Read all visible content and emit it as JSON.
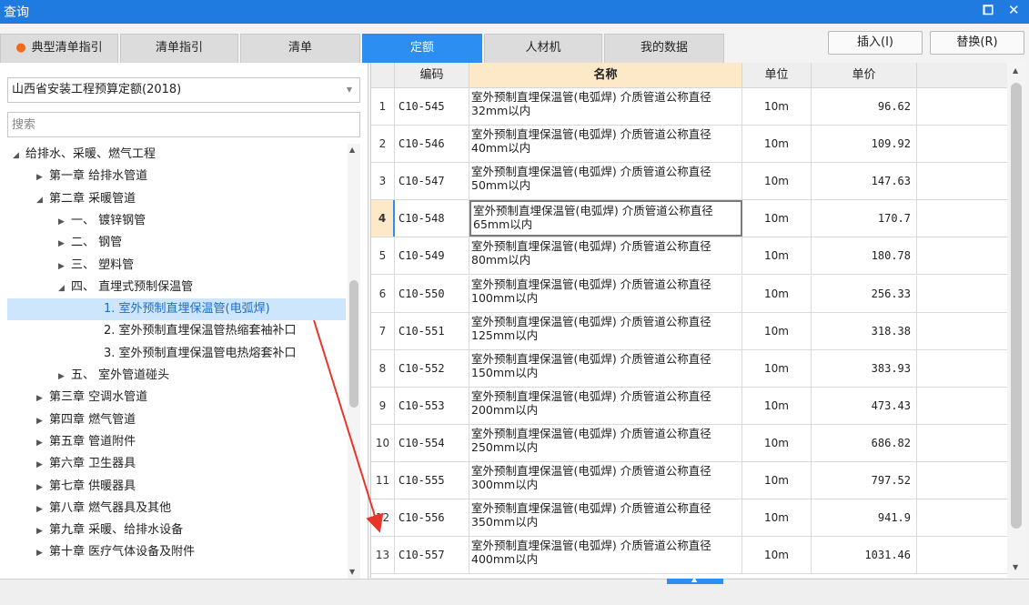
{
  "window": {
    "title": "查询",
    "restore_glyph": "⧠",
    "close_glyph": "✕"
  },
  "tabs": [
    {
      "label": "典型清单指引",
      "icon": "flame-icon",
      "active": false
    },
    {
      "label": "清单指引",
      "active": false
    },
    {
      "label": "清单",
      "active": false
    },
    {
      "label": "定额",
      "active": true
    },
    {
      "label": "人材机",
      "active": false
    },
    {
      "label": "我的数据",
      "active": false
    }
  ],
  "actions": {
    "insert_label": "插入(I)",
    "replace_label": "替换(R)"
  },
  "left": {
    "dataset_select": "山西省安装工程预算定额(2018)",
    "search_placeholder": "搜索",
    "tree": [
      {
        "label": "给排水、采暖、燃气工程",
        "level": 0,
        "arrow": "◢"
      },
      {
        "label": "第一章 给排水管道",
        "level": 1,
        "arrow": "▶"
      },
      {
        "label": "第二章 采暖管道",
        "level": 1,
        "arrow": "◢"
      },
      {
        "label": "一、 镀锌钢管",
        "level": 2,
        "arrow": "▶"
      },
      {
        "label": "二、 钢管",
        "level": 2,
        "arrow": "▶"
      },
      {
        "label": "三、 塑料管",
        "level": 2,
        "arrow": "▶"
      },
      {
        "label": "四、 直埋式预制保温管",
        "level": 2,
        "arrow": "◢"
      },
      {
        "label": "1. 室外预制直埋保温管(电弧焊)",
        "level": 3,
        "arrow": "",
        "selected": true
      },
      {
        "label": "2. 室外预制直埋保温管热缩套袖补口",
        "level": 3,
        "arrow": ""
      },
      {
        "label": "3. 室外预制直埋保温管电热熔套补口",
        "level": 3,
        "arrow": ""
      },
      {
        "label": "五、 室外管道碰头",
        "level": 2,
        "arrow": "▶"
      },
      {
        "label": "第三章 空调水管道",
        "level": 1,
        "arrow": "▶"
      },
      {
        "label": "第四章 燃气管道",
        "level": 1,
        "arrow": "▶"
      },
      {
        "label": "第五章 管道附件",
        "level": 1,
        "arrow": "▶"
      },
      {
        "label": "第六章 卫生器具",
        "level": 1,
        "arrow": "▶"
      },
      {
        "label": "第七章 供暖器具",
        "level": 1,
        "arrow": "▶"
      },
      {
        "label": "第八章 燃气器具及其他",
        "level": 1,
        "arrow": "▶"
      },
      {
        "label": "第九章 采暖、给排水设备",
        "level": 1,
        "arrow": "▶"
      },
      {
        "label": "第十章 医疗气体设备及附件",
        "level": 1,
        "arrow": "▶"
      }
    ]
  },
  "grid": {
    "columns": {
      "index": "",
      "code": "编码",
      "name": "名称",
      "unit": "单位",
      "price": "单价"
    },
    "current_row": 4,
    "rows": [
      {
        "index": "1",
        "code": "C10-545",
        "name": "室外预制直埋保温管(电弧焊) 介质管道公称直径32mm以内",
        "unit": "10m",
        "price": "96.62"
      },
      {
        "index": "2",
        "code": "C10-546",
        "name": "室外预制直埋保温管(电弧焊) 介质管道公称直径40mm以内",
        "unit": "10m",
        "price": "109.92"
      },
      {
        "index": "3",
        "code": "C10-547",
        "name": "室外预制直埋保温管(电弧焊) 介质管道公称直径50mm以内",
        "unit": "10m",
        "price": "147.63"
      },
      {
        "index": "4",
        "code": "C10-548",
        "name": "室外预制直埋保温管(电弧焊) 介质管道公称直径65mm以内",
        "unit": "10m",
        "price": "170.7"
      },
      {
        "index": "5",
        "code": "C10-549",
        "name": "室外预制直埋保温管(电弧焊) 介质管道公称直径80mm以内",
        "unit": "10m",
        "price": "180.78"
      },
      {
        "index": "6",
        "code": "C10-550",
        "name": "室外预制直埋保温管(电弧焊) 介质管道公称直径100mm以内",
        "unit": "10m",
        "price": "256.33"
      },
      {
        "index": "7",
        "code": "C10-551",
        "name": "室外预制直埋保温管(电弧焊) 介质管道公称直径125mm以内",
        "unit": "10m",
        "price": "318.38"
      },
      {
        "index": "8",
        "code": "C10-552",
        "name": "室外预制直埋保温管(电弧焊) 介质管道公称直径150mm以内",
        "unit": "10m",
        "price": "383.93"
      },
      {
        "index": "9",
        "code": "C10-553",
        "name": "室外预制直埋保温管(电弧焊) 介质管道公称直径200mm以内",
        "unit": "10m",
        "price": "473.43"
      },
      {
        "index": "10",
        "code": "C10-554",
        "name": "室外预制直埋保温管(电弧焊) 介质管道公称直径250mm以内",
        "unit": "10m",
        "price": "686.82"
      },
      {
        "index": "11",
        "code": "C10-555",
        "name": "室外预制直埋保温管(电弧焊) 介质管道公称直径300mm以内",
        "unit": "10m",
        "price": "797.52"
      },
      {
        "index": "12",
        "code": "C10-556",
        "name": "室外预制直埋保温管(电弧焊) 介质管道公称直径350mm以内",
        "unit": "10m",
        "price": "941.9"
      },
      {
        "index": "13",
        "code": "C10-557",
        "name": "室外预制直埋保温管(电弧焊) 介质管道公称直径400mm以内",
        "unit": "10m",
        "price": "1031.46"
      }
    ]
  },
  "annotation": {
    "color": "#e8342a"
  }
}
